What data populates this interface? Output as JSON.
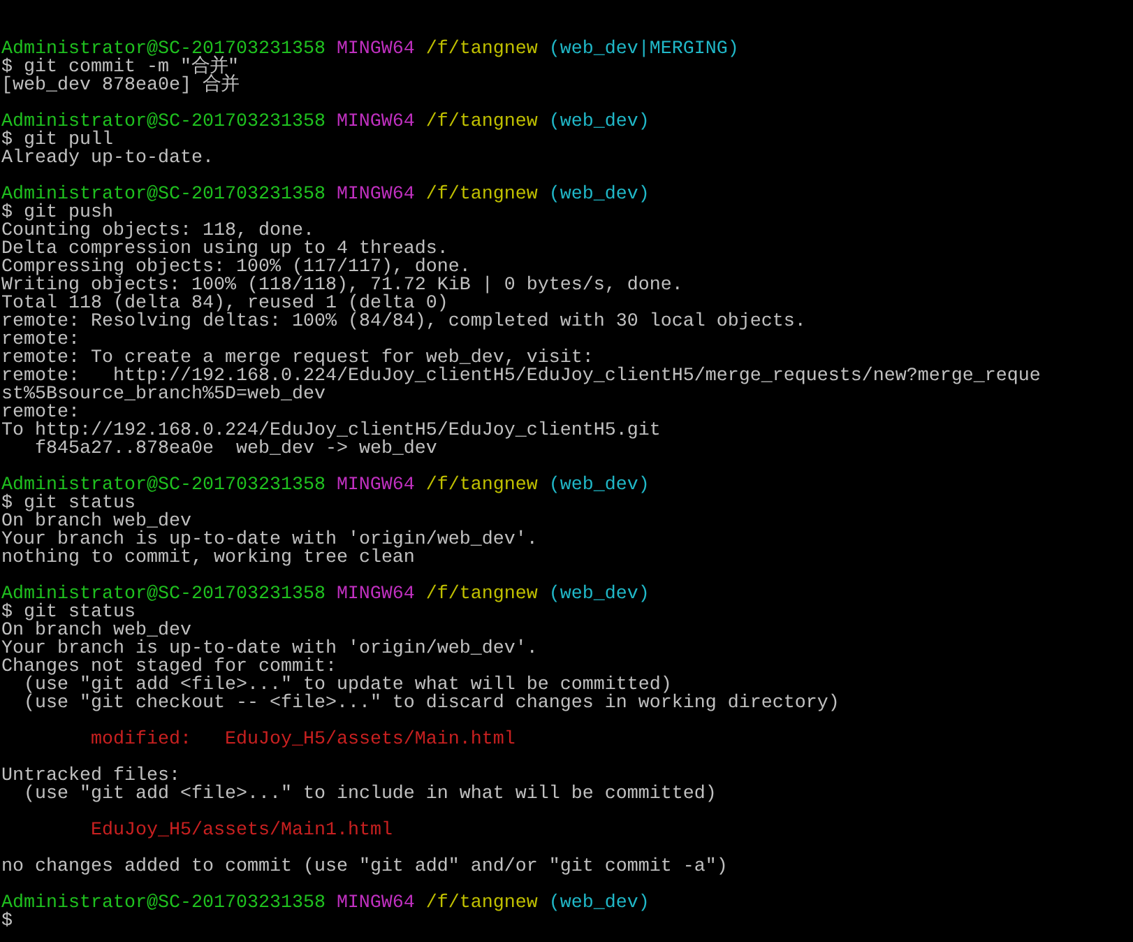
{
  "terminal": {
    "lines": [
      {
        "kind": "prompt",
        "user": "Administrator@SC-201703231358",
        "system": "MINGW64",
        "path": "/f/tangnew",
        "branch": "(web_dev|MERGING)"
      },
      {
        "kind": "command",
        "text": "$ git commit -m \"合并\""
      },
      {
        "kind": "output",
        "text": "[web_dev 878ea0e] 合并"
      },
      {
        "kind": "blank"
      },
      {
        "kind": "prompt",
        "user": "Administrator@SC-201703231358",
        "system": "MINGW64",
        "path": "/f/tangnew",
        "branch": "(web_dev)"
      },
      {
        "kind": "command",
        "text": "$ git pull"
      },
      {
        "kind": "output",
        "text": "Already up-to-date."
      },
      {
        "kind": "blank"
      },
      {
        "kind": "prompt",
        "user": "Administrator@SC-201703231358",
        "system": "MINGW64",
        "path": "/f/tangnew",
        "branch": "(web_dev)"
      },
      {
        "kind": "command",
        "text": "$ git push"
      },
      {
        "kind": "output",
        "text": "Counting objects: 118, done."
      },
      {
        "kind": "output",
        "text": "Delta compression using up to 4 threads."
      },
      {
        "kind": "output",
        "text": "Compressing objects: 100% (117/117), done."
      },
      {
        "kind": "output",
        "text": "Writing objects: 100% (118/118), 71.72 KiB | 0 bytes/s, done."
      },
      {
        "kind": "output",
        "text": "Total 118 (delta 84), reused 1 (delta 0)"
      },
      {
        "kind": "output",
        "text": "remote: Resolving deltas: 100% (84/84), completed with 30 local objects."
      },
      {
        "kind": "output",
        "text": "remote:"
      },
      {
        "kind": "output",
        "text": "remote: To create a merge request for web_dev, visit:"
      },
      {
        "kind": "output",
        "text": "remote:   http://192.168.0.224/EduJoy_clientH5/EduJoy_clientH5/merge_requests/new?merge_reque"
      },
      {
        "kind": "output",
        "text": "st%5Bsource_branch%5D=web_dev"
      },
      {
        "kind": "output",
        "text": "remote:"
      },
      {
        "kind": "output",
        "text": "To http://192.168.0.224/EduJoy_clientH5/EduJoy_clientH5.git"
      },
      {
        "kind": "output",
        "text": "   f845a27..878ea0e  web_dev -> web_dev"
      },
      {
        "kind": "blank"
      },
      {
        "kind": "prompt",
        "user": "Administrator@SC-201703231358",
        "system": "MINGW64",
        "path": "/f/tangnew",
        "branch": "(web_dev)"
      },
      {
        "kind": "command",
        "text": "$ git status"
      },
      {
        "kind": "output",
        "text": "On branch web_dev"
      },
      {
        "kind": "output",
        "text": "Your branch is up-to-date with 'origin/web_dev'."
      },
      {
        "kind": "output",
        "text": "nothing to commit, working tree clean"
      },
      {
        "kind": "blank"
      },
      {
        "kind": "prompt",
        "user": "Administrator@SC-201703231358",
        "system": "MINGW64",
        "path": "/f/tangnew",
        "branch": "(web_dev)"
      },
      {
        "kind": "command",
        "text": "$ git status"
      },
      {
        "kind": "output",
        "text": "On branch web_dev"
      },
      {
        "kind": "output",
        "text": "Your branch is up-to-date with 'origin/web_dev'."
      },
      {
        "kind": "output",
        "text": "Changes not staged for commit:"
      },
      {
        "kind": "output",
        "text": "  (use \"git add <file>...\" to update what will be committed)"
      },
      {
        "kind": "output",
        "text": "  (use \"git checkout -- <file>...\" to discard changes in working directory)"
      },
      {
        "kind": "blank"
      },
      {
        "kind": "file",
        "text": "        modified:   EduJoy_H5/assets/Main.html"
      },
      {
        "kind": "blank"
      },
      {
        "kind": "output",
        "text": "Untracked files:"
      },
      {
        "kind": "output",
        "text": "  (use \"git add <file>...\" to include in what will be committed)"
      },
      {
        "kind": "blank"
      },
      {
        "kind": "file",
        "text": "        EduJoy_H5/assets/Main1.html"
      },
      {
        "kind": "blank"
      },
      {
        "kind": "output",
        "text": "no changes added to commit (use \"git add\" and/or \"git commit -a\")"
      },
      {
        "kind": "blank"
      },
      {
        "kind": "prompt",
        "user": "Administrator@SC-201703231358",
        "system": "MINGW64",
        "path": "/f/tangnew",
        "branch": "(web_dev)"
      },
      {
        "kind": "command",
        "text": "$"
      }
    ]
  }
}
